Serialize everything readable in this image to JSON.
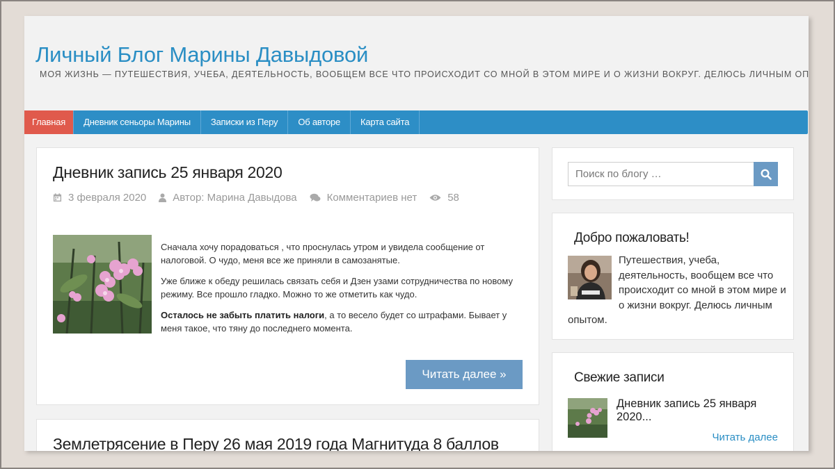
{
  "site": {
    "title": "Личный Блог Марины Давыдовой",
    "description": "МОЯ ЖИЗНЬ — ПУТЕШЕСТВИЯ, УЧЕБА, ДЕЯТЕЛЬНОСТЬ, ВООБЩЕМ ВСЕ ЧТО ПРОИСХОДИТ СО МНОЙ В ЭТОМ МИРЕ И О ЖИЗНИ ВОКРУГ. ДЕЛЮСЬ ЛИЧНЫМ ОПЫТОМ."
  },
  "nav": {
    "items": [
      {
        "label": "Главная",
        "active": true
      },
      {
        "label": "Дневник сеньоры Марины"
      },
      {
        "label": "Записки из Перу"
      },
      {
        "label": "Об авторе"
      },
      {
        "label": "Карта сайта"
      }
    ]
  },
  "posts": [
    {
      "title": "Дневник запись 25 января 2020",
      "date": "3 февраля 2020",
      "author": "Автор: Марина Давыдова",
      "comments": "Комментариев нет",
      "views": "58",
      "excerpt": {
        "p1": "Сначала хочу порадоваться , что проснулась утром и увидела сообщение от налоговой. О чудо, меня все же приняли в самозанятые.",
        "p2": "Уже ближе к обеду решилась связать себя и Дзен узами сотрудничества по новому режиму. Все прошло гладко. Можно то же отметить как чудо.",
        "p3_bold": "Осталось не забыть платить налоги",
        "p3_rest": ", а то весело будет со штрафами. Бывает у меня такое, что тяну до последнего момента."
      },
      "read_more": "Читать далее »"
    },
    {
      "title": "Землетрясение в Перу 26 мая 2019 года Магнитуда 8 баллов"
    }
  ],
  "sidebar": {
    "search": {
      "placeholder": "Поиск по блогу …"
    },
    "welcome": {
      "title": "Добро пожаловать!",
      "text": "Путешествия, учеба, деятельность, вообщем все что происходит со мной в этом мире и о жизни вокруг. Делюсь личным опытом."
    },
    "recent": {
      "title": "Свежие записи",
      "item_title": "Дневник запись 25 января 2020...",
      "item_more": "Читать далее"
    }
  },
  "colors": {
    "accent": "#2a8ec4",
    "nav_bg": "#2d8ec6",
    "nav_active": "#e05a4c",
    "button": "#6b9ac4"
  },
  "icons": [
    "calendar-icon",
    "user-icon",
    "comments-icon",
    "eye-icon",
    "search-icon"
  ]
}
